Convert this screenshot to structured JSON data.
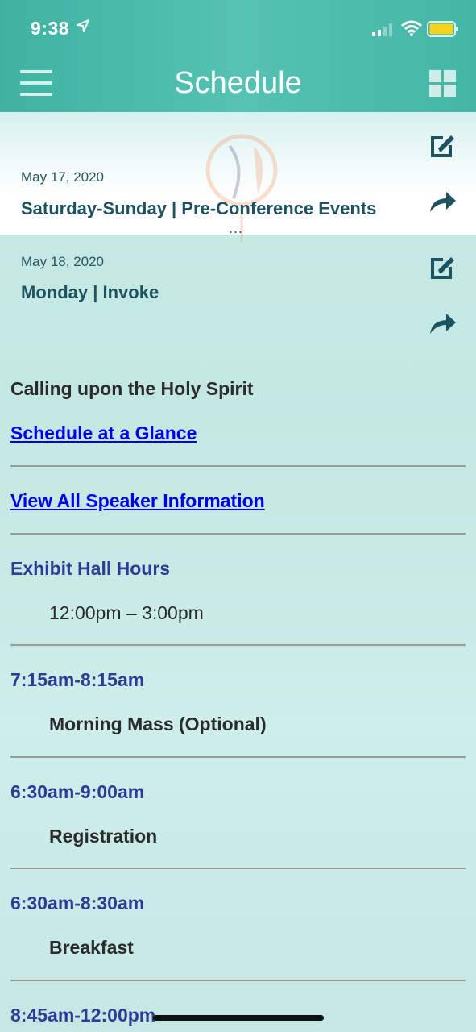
{
  "status_bar": {
    "time": "9:38",
    "icons": [
      "location-arrow-icon",
      "cellular-signal-icon",
      "wifi-icon",
      "battery-icon"
    ],
    "battery_color": "#f3d21b"
  },
  "nav": {
    "title": "Schedule",
    "left_icon": "hamburger-menu-icon",
    "right_icon": "grid-view-icon"
  },
  "days": [
    {
      "date": "May 17, 2020",
      "title": "Saturday-Sunday | Pre-Conference Events",
      "selected": true
    },
    {
      "date": "May 18, 2020",
      "title": "Monday | Invoke",
      "selected": false
    }
  ],
  "more_indicator": "...",
  "content": {
    "subtitle": "Calling upon the Holy Spirit",
    "links": [
      "Schedule at a Glance",
      "View All Speaker Information"
    ],
    "exhibit": {
      "heading": "Exhibit Hall Hours",
      "hours": "12:00pm – 3:00pm"
    },
    "events": [
      {
        "time": "7:15am-8:15am",
        "name": "Morning Mass (Optional)"
      },
      {
        "time": "6:30am-9:00am",
        "name": "Registration"
      },
      {
        "time": "6:30am-8:30am",
        "name": "Breakfast"
      },
      {
        "time": "8:45am-12:00pm",
        "name": ""
      }
    ]
  },
  "colors": {
    "header": "#45b6a6",
    "background": "#c6e8e4",
    "day_title": "#1d5360",
    "time_heading": "#2f3b94",
    "link": "#0000ee"
  }
}
